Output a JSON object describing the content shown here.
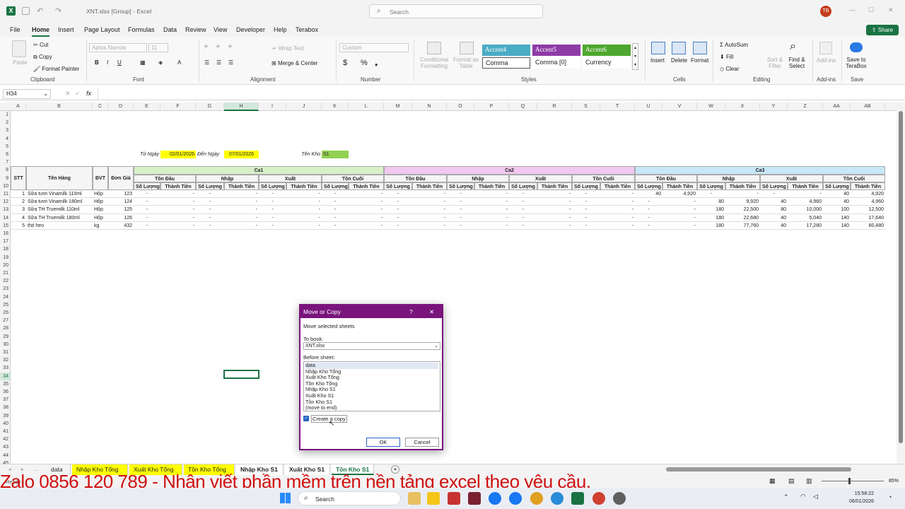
{
  "window": {
    "title": "XNT.xlsx [Group]  -  Excel",
    "search_placeholder": "Search",
    "user_initials": "TB",
    "share_label": "Share"
  },
  "menu": [
    "File",
    "Home",
    "Insert",
    "Page Layout",
    "Formulas",
    "Data",
    "Review",
    "View",
    "Developer",
    "Help",
    "Terabox"
  ],
  "ribbon": {
    "clipboard": {
      "paste": "Paste",
      "cut": "Cut",
      "copy": "Copy",
      "format_painter": "Format Painter",
      "group": "Clipboard"
    },
    "font": {
      "name": "Aptos Narrow",
      "size": "11",
      "group": "Font"
    },
    "alignment": {
      "wrap": "Wrap Text",
      "merge": "Merge & Center",
      "group": "Alignment"
    },
    "number": {
      "format": "Custom",
      "group": "Number",
      "pct": "%"
    },
    "styles": {
      "cond": "Conditional Formatting",
      "fmt_table": "Format as Table",
      "accent4": "Accent4",
      "accent5": "Accent5",
      "accent6": "Accent6",
      "comma": "Comma",
      "comma0": "Comma [0]",
      "currency": "Currency",
      "group": "Styles"
    },
    "cells": {
      "insert": "Insert",
      "delete": "Delete",
      "format": "Format",
      "group": "Cells"
    },
    "editing": {
      "autosum": "AutoSum",
      "fill": "Fill",
      "clear": "Clear",
      "sort": "Sort & Filter",
      "find": "Find & Select",
      "group": "Editing"
    },
    "addins": {
      "label": "Add-ins",
      "group": "Add-ins"
    },
    "save": {
      "label": "Save to TeraBox",
      "group": "Save"
    },
    "colors": {
      "accent4": "#4bacc6",
      "accent5": "#8e3ba6",
      "accent6": "#4ea72e"
    }
  },
  "formula_bar": {
    "name_box": "H34",
    "fx": "fx"
  },
  "columns": [
    "A",
    "B",
    "C",
    "D",
    "E",
    "F",
    "G",
    "H",
    "I",
    "J",
    "K",
    "L",
    "M",
    "N",
    "O",
    "P",
    "Q",
    "R",
    "S",
    "T",
    "U",
    "V",
    "W",
    "X",
    "Y",
    "Z",
    "AA",
    "AB"
  ],
  "sheet": {
    "tu_ngay_label": "Từ Ngày",
    "tu_ngay": "02/01/2026",
    "den_ngay_label": "Đến Ngày",
    "den_ngay": "07/01/2026",
    "ten_kho_label": "Tên Kho",
    "ten_kho": "S1",
    "stt": "STT",
    "ten_hang": "Tên Hàng",
    "dvt": "ĐVT",
    "don_gia": "Đơn Giá",
    "ca": [
      "Ca1",
      "Ca2",
      "Ca3"
    ],
    "sub": [
      "Tồn Đầu",
      "Nhập",
      "Xuất",
      "Tồn Cuối"
    ],
    "sl": "Số Lượng",
    "tt": "Thành Tiền",
    "items": [
      {
        "stt": "1",
        "name": "Sữa tươi Vinamilk 110ml",
        "dvt": "Hộp",
        "gia": "123",
        "ca3": [
          "40",
          "4,920",
          "-",
          "-",
          "-",
          "-",
          "40",
          "4,920"
        ]
      },
      {
        "stt": "2",
        "name": "Sữa tươi Vinamilk 180ml",
        "dvt": "Hộp",
        "gia": "124",
        "ca3": [
          "-",
          "-",
          "80",
          "9,920",
          "40",
          "4,960",
          "40",
          "4,960"
        ]
      },
      {
        "stt": "3",
        "name": "Sữa TH Truemilk 110ml",
        "dvt": "Hộp",
        "gia": "125",
        "ca3": [
          "-",
          "-",
          "180",
          "22,500",
          "80",
          "10,000",
          "100",
          "12,500"
        ]
      },
      {
        "stt": "4",
        "name": "Sữa TH Truemilk 180ml",
        "dvt": "Hộp",
        "gia": "126",
        "ca3": [
          "-",
          "-",
          "180",
          "22,680",
          "40",
          "5,040",
          "140",
          "17,640"
        ]
      },
      {
        "stt": "5",
        "name": "thịt heo",
        "dvt": "kg",
        "gia": "432",
        "ca3": [
          "-",
          "-",
          "180",
          "77,760",
          "40",
          "17,280",
          "140",
          "60,480"
        ]
      }
    ],
    "dash": "-"
  },
  "dialog": {
    "title": "Move or Copy",
    "help": "?",
    "close": "✕",
    "move_label": "Move selected sheets",
    "to_book_label": "To book:",
    "to_book": "XNT.xlsx",
    "before_label": "Before sheet:",
    "sheets": [
      "data",
      "Nhập Kho Tổng",
      "Xuất Kho Tổng",
      "Tồn Kho Tổng",
      "Nhập Kho S1",
      "Xuất Kho S1",
      "Tồn Kho S1",
      "(move to end)"
    ],
    "create_copy": "Create a copy",
    "ok": "OK",
    "cancel": "Cancel"
  },
  "tabs": [
    {
      "label": "data",
      "color": "#f3f3f3"
    },
    {
      "label": "Nhập Kho Tổng",
      "color": "#ffff00"
    },
    {
      "label": "Xuất Kho Tổng",
      "color": "#ffff00"
    },
    {
      "label": "Tồn Kho Tổng",
      "color": "#ffff00"
    },
    {
      "label": "Nhập Kho S1",
      "color": "#ffffff"
    },
    {
      "label": "Xuất Kho S1",
      "color": "#ffffff"
    },
    {
      "label": "Tồn Kho S1",
      "color": "#ffffff"
    }
  ],
  "status": {
    "left": "Ready",
    "zoom": "85%"
  },
  "watermark": "Zalo 0856 120 789 - Nhận viết phần mềm trên nền tảng excel theo yêu cầu.",
  "taskbar": {
    "search": "Search",
    "time": "15:58:22",
    "date": "06/01/2026"
  }
}
